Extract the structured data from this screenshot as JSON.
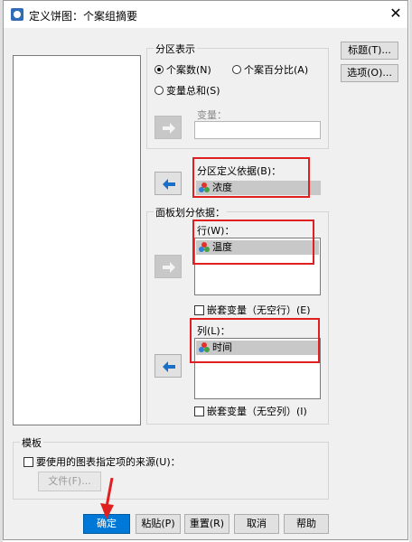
{
  "window": {
    "title": "定义饼图：个案组摘要",
    "close_symbol": "✕"
  },
  "partition": {
    "group_title": "分区表示",
    "options": [
      {
        "label": "个案数(N)",
        "selected": true
      },
      {
        "label": "个案百分比(A)",
        "selected": false
      },
      {
        "label": "变量总和(S)",
        "selected": false
      }
    ],
    "variable_label": "变量：",
    "variable_value": ""
  },
  "side_buttons": {
    "titles": "标题(T)...",
    "options": "选项(O)..."
  },
  "define_by": {
    "label": "分区定义依据(B)：",
    "variable": "浓度"
  },
  "panel": {
    "group_title": "面板划分依据：",
    "row_label": "行(W)：",
    "row_variable": "温度",
    "nest_rows": "嵌套变量（无空行）(E)",
    "col_label": "列(L)：",
    "col_variable": "时间",
    "nest_cols": "嵌套变量（无空列）(I)"
  },
  "template": {
    "group_title": "模板",
    "use_chart_spec": "要使用的图表指定项的来源(U)：",
    "file_button": "文件(F)..."
  },
  "footer": {
    "ok": "确定",
    "paste": "粘贴(P)",
    "reset": "重置(R)",
    "cancel": "取消",
    "help": "帮助"
  },
  "colors": {
    "annotation_red": "#e02020",
    "primary_blue": "#0078d7"
  }
}
